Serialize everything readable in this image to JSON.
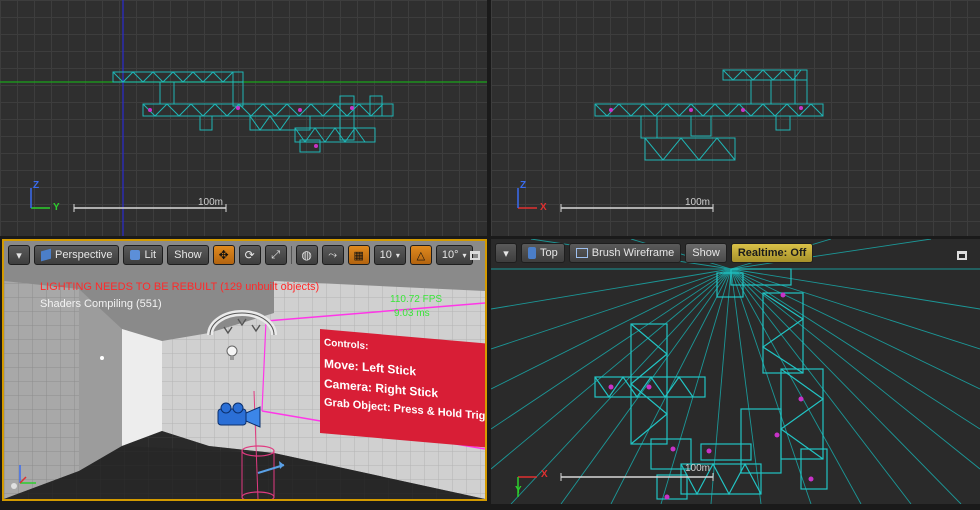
{
  "viewports": {
    "top_left": {
      "scale_label": "100m",
      "axis_a": "Z",
      "axis_b": "Y"
    },
    "top_right": {
      "scale_label": "100m",
      "axis_a": "Z",
      "axis_b": "X"
    },
    "perspective": {
      "toolbar": {
        "menu_label": "▾",
        "view_mode_label": "Perspective",
        "lit_label": "Lit",
        "show_label": "Show",
        "grid_snap_value": "10",
        "angle_snap_value": "10°",
        "expand_label": "»"
      },
      "overlay": {
        "lighting_warning": "LIGHTING NEEDS TO BE REBUILT (129 unbuilt objects)",
        "shaders_compiling": "Shaders Compiling (551)",
        "fps": "110.72 FPS",
        "ms": "9.03 ms"
      },
      "sign": {
        "controls": "Controls:",
        "move": "Move: Left Stick",
        "camera": "Camera: Right Stick",
        "grab": "Grab Object: Press & Hold Trigger"
      }
    },
    "top_bottom": {
      "toolbar": {
        "menu_label": "▾",
        "view_mode_label": "Top",
        "render_mode_label": "Brush Wireframe",
        "show_label": "Show",
        "realtime_label": "Realtime: Off"
      },
      "scale_label": "100m",
      "axis_a": "Y",
      "axis_b": "X"
    }
  },
  "colors": {
    "wire": "#1fb5b5",
    "selected_border": "#e0a000",
    "warning_red": "#ff2a2a",
    "fps_green": "#39e639",
    "sign_red": "#d81e36"
  }
}
